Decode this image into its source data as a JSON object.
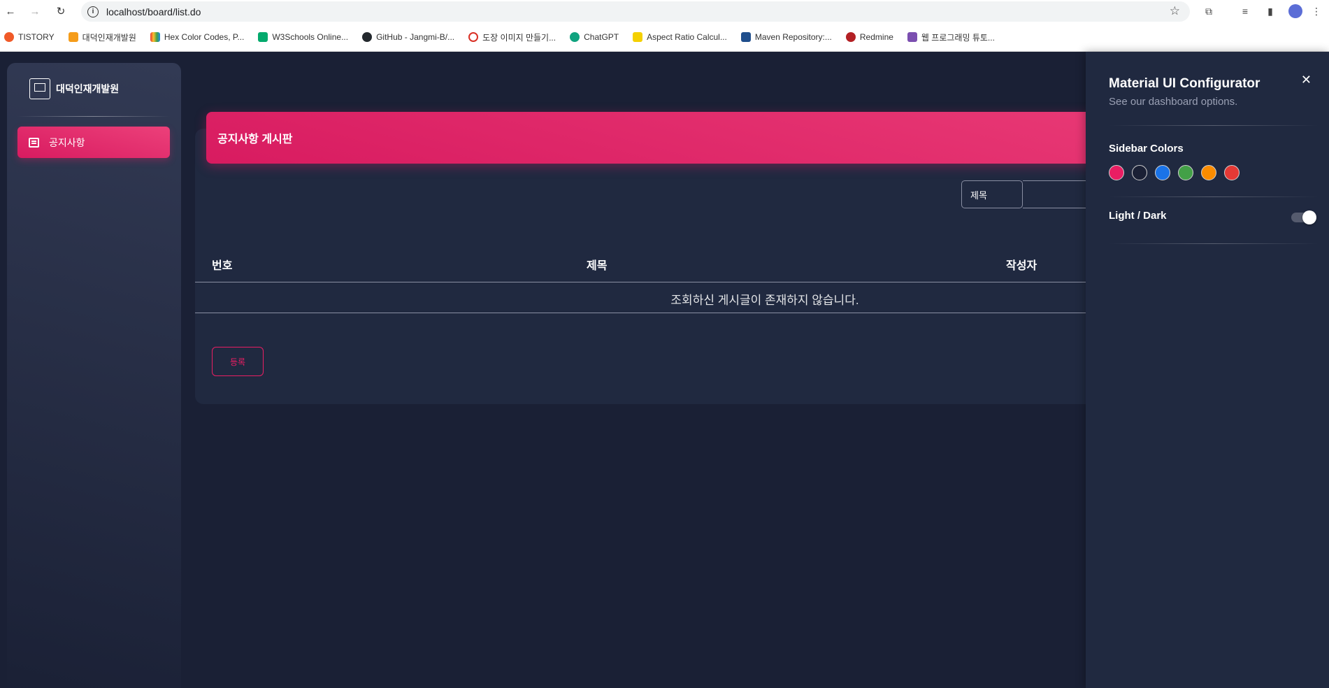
{
  "browser": {
    "url": "localhost/board/list.do",
    "bookmarks": [
      {
        "label": "TISTORY",
        "color": "#f05a28"
      },
      {
        "label": "대덕인재개발원",
        "color": "#f59c1a"
      },
      {
        "label": "Hex Color Codes, P...",
        "color": "#6a5acd"
      },
      {
        "label": "W3Schools Online...",
        "color": "#04aa6d"
      },
      {
        "label": "GitHub - Jangmi-B/...",
        "color": "#24292e"
      },
      {
        "label": "도장 이미지 만들기...",
        "color": "#d93025"
      },
      {
        "label": "ChatGPT",
        "color": "#10a37f"
      },
      {
        "label": "Aspect Ratio Calcul...",
        "color": "#f4d000"
      },
      {
        "label": "Maven Repository:...",
        "color": "#1f4e8c"
      },
      {
        "label": "Redmine",
        "color": "#b32024"
      },
      {
        "label": "웹 프로그래밍 튜토...",
        "color": "#7b4fb0"
      }
    ]
  },
  "sidebar": {
    "brand": "대덕인재개발원",
    "items": [
      {
        "label": "공지사항"
      }
    ]
  },
  "board": {
    "title": "공지사항 게시판",
    "search_field": "제목",
    "columns": [
      "번호",
      "제목",
      "작성자"
    ],
    "empty_message": "조회하신 게시글이 존재하지 않습니다.",
    "register_label": "등록"
  },
  "configurator": {
    "title": "Material UI Configurator",
    "subtitle": "See our dashboard options.",
    "sidebar_colors_label": "Sidebar Colors",
    "sidebar_colors": [
      "#e91e63",
      "#1a2035",
      "#1a73e8",
      "#43a047",
      "#fb8c00",
      "#e53935"
    ],
    "light_dark_label": "Light / Dark",
    "dark_mode": true
  }
}
